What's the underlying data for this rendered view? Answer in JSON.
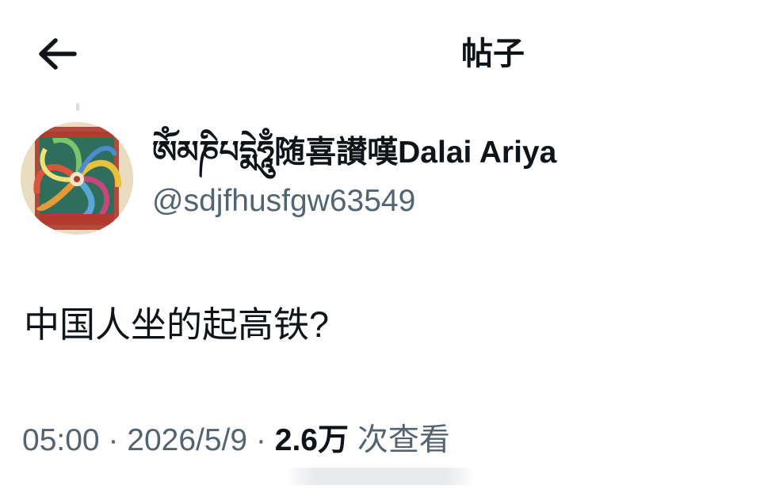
{
  "header": {
    "title": "帖子",
    "back_icon": "arrow-left-icon"
  },
  "author": {
    "display_name": "ཨོཾམཎིཔདྨེཧཱུྃ随喜讃嘆Dalai Ariya",
    "handle": "@sdjfhusfgw63549",
    "avatar_icon": "thangka-avatar"
  },
  "tweet": {
    "text": "中国人坐的起高铁?"
  },
  "meta": {
    "time": "05:00",
    "separator": " · ",
    "date": "2026/5/9",
    "views_count": "2.6万",
    "views_label": " 次查看"
  },
  "colors": {
    "text_primary": "#0f1419",
    "text_secondary": "#536471",
    "background": "#ffffff"
  }
}
